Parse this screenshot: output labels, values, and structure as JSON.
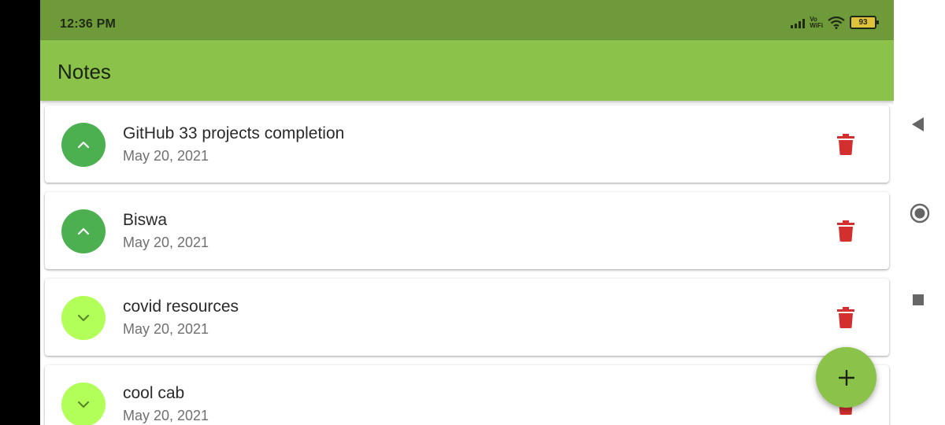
{
  "status_bar": {
    "time": "12:36 PM",
    "vowifi_top": "Vo",
    "vowifi_bottom": "WiFi",
    "battery": "93"
  },
  "app_bar": {
    "title": "Notes"
  },
  "notes": [
    {
      "title": "GitHub 33 projects completion",
      "date": "May 20, 2021",
      "expanded": true
    },
    {
      "title": "Biswa",
      "date": "May 20, 2021",
      "expanded": true
    },
    {
      "title": "covid resources",
      "date": "May 20, 2021",
      "expanded": false
    },
    {
      "title": "cool cab",
      "date": "May 20, 2021",
      "expanded": false
    }
  ],
  "colors": {
    "status_bar": "#6e9a3a",
    "app_bar": "#8bc34a",
    "expanded_button": "#4caf50",
    "collapsed_button": "#b2ff59",
    "delete": "#d32f2f",
    "fab": "#8bc34a"
  },
  "icons": {
    "expanded": "chevron-up-icon",
    "collapsed": "chevron-down-icon",
    "delete": "trash-icon",
    "fab": "plus-icon"
  }
}
